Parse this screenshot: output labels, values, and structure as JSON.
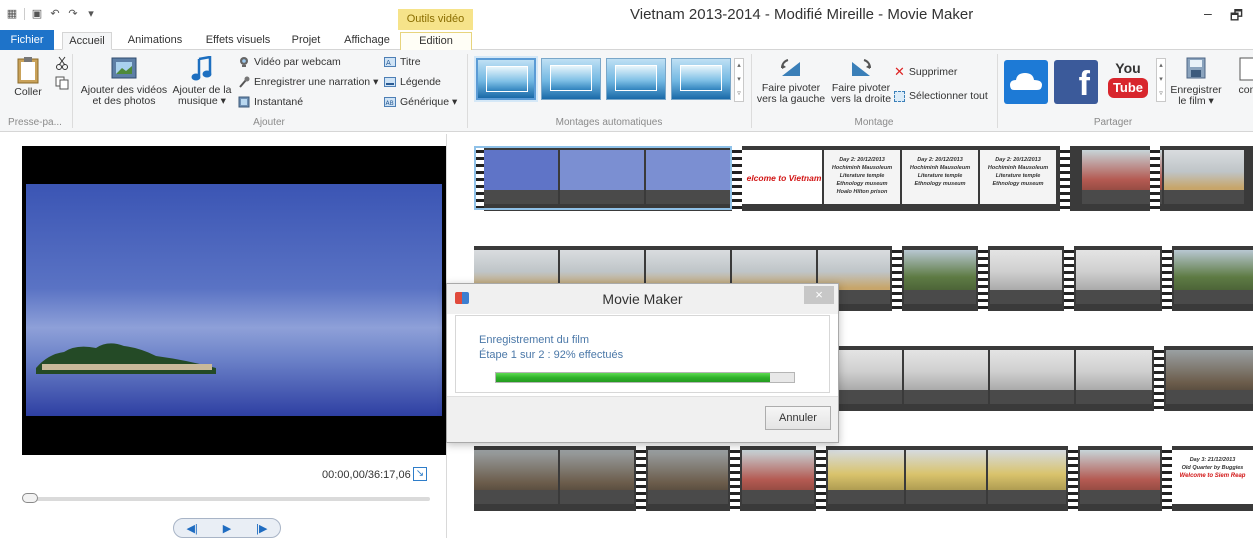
{
  "window": {
    "title": "Vietnam 2013-2014 - Modifié Mireille - Movie Maker",
    "context_tab_label": "Outils vidéo",
    "minimize": "–",
    "restore": "🗗"
  },
  "tabs": [
    {
      "label": "Fichier"
    },
    {
      "label": "Accueil"
    },
    {
      "label": "Animations"
    },
    {
      "label": "Effets visuels"
    },
    {
      "label": "Projet"
    },
    {
      "label": "Affichage"
    },
    {
      "label": "Edition"
    }
  ],
  "ribbon": {
    "clipboard": {
      "paste": "Coller",
      "group": "Presse-pa..."
    },
    "add": {
      "add_videos_line1": "Ajouter des vidéos",
      "add_videos_line2": "et des photos",
      "add_music_line1": "Ajouter de la",
      "add_music_line2": "musique ▾",
      "webcam": "Vidéo par webcam",
      "narration": "Enregistrer une narration ▾",
      "snapshot": "Instantané",
      "title": "Titre",
      "caption": "Légende",
      "credits": "Générique ▾",
      "group": "Ajouter"
    },
    "automovie": {
      "group": "Montages automatiques"
    },
    "editing": {
      "rotate_left_line1": "Faire pivoter",
      "rotate_left_line2": "vers la gauche",
      "rotate_right_line1": "Faire pivoter",
      "rotate_right_line2": "vers la droite",
      "delete": "Supprimer",
      "select_all": "Sélectionner tout",
      "group": "Montage"
    },
    "share": {
      "youtube_top": "You",
      "youtube_bottom": "Tube",
      "facebook": "f",
      "save_line1": "Enregistrer",
      "save_line2": "le film ▾",
      "cut_label": "con",
      "group": "Partager"
    }
  },
  "preview": {
    "timecode": "00:00,00/36:17,06",
    "transport_prev": "◀|",
    "transport_play": "▶",
    "transport_next": "|▶"
  },
  "storyboard": {
    "title_card": "elcome to Vietnam",
    "day2_lines": [
      "Day 2: 20/12/2013",
      "Hochiminh Mausoleum",
      "Literature temple",
      "Ethnology museum",
      "Hoalo Hilton prison"
    ],
    "day3_lines": [
      "Day 3: 21/12/2013",
      "Old Quarter by Buggies"
    ],
    "day3_title": "Welcome to Siem Reap"
  },
  "dialog": {
    "title": "Movie Maker",
    "close": "×",
    "status_line": "Enregistrement du film",
    "step_line": "Étape 1 sur 2 : 92% effectués",
    "progress_fraction": 0.92,
    "cancel": "Annuler"
  }
}
